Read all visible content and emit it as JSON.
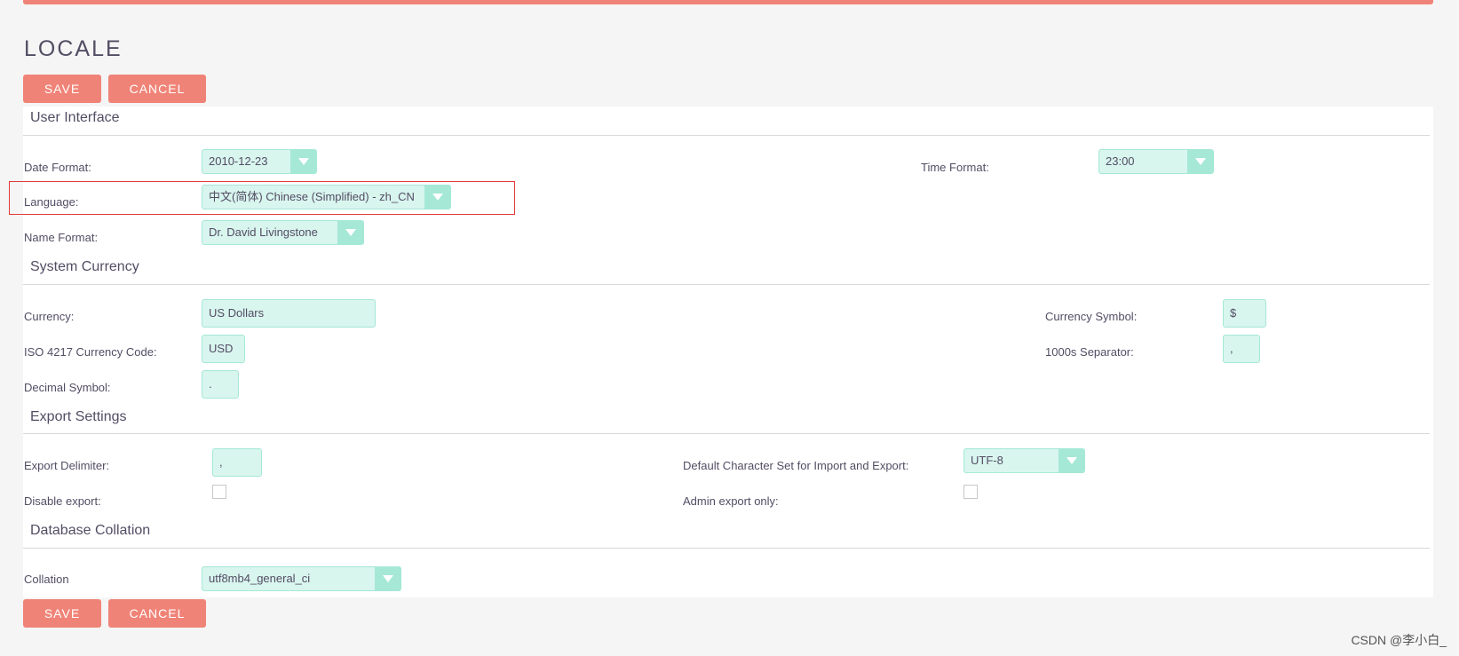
{
  "page": {
    "title": "LOCALE"
  },
  "buttons": {
    "save_label": "SAVE",
    "cancel_label": "CANCEL"
  },
  "sections": {
    "user_interface": {
      "title": "User Interface",
      "date_format": {
        "label": "Date Format:",
        "value": "2010-12-23"
      },
      "time_format": {
        "label": "Time Format:",
        "value": "23:00"
      },
      "language": {
        "label": "Language:",
        "value": "中文(简体) Chinese (Simplified) - zh_CN"
      },
      "name_format": {
        "label": "Name Format:",
        "value": "Dr. David Livingstone"
      }
    },
    "system_currency": {
      "title": "System Currency",
      "currency": {
        "label": "Currency:",
        "value": "US Dollars"
      },
      "currency_symbol": {
        "label": "Currency Symbol:",
        "value": "$"
      },
      "iso_code": {
        "label": "ISO 4217 Currency Code:",
        "value": "USD"
      },
      "thousands_separator": {
        "label": "1000s Separator:",
        "value": ","
      },
      "decimal_symbol": {
        "label": "Decimal Symbol:",
        "value": "."
      }
    },
    "export_settings": {
      "title": "Export Settings",
      "export_delimiter": {
        "label": "Export Delimiter:",
        "value": ","
      },
      "default_charset": {
        "label": "Default Character Set for Import and Export:",
        "value": "UTF-8"
      },
      "disable_export": {
        "label": "Disable export:",
        "checked": false
      },
      "admin_export_only": {
        "label": "Admin export only:",
        "checked": false
      }
    },
    "database_collation": {
      "title": "Database Collation",
      "collation": {
        "label": "Collation",
        "value": "utf8mb4_general_ci"
      }
    }
  },
  "watermark": "CSDN @李小白_",
  "colors": {
    "accent": "#f08377",
    "field_bg": "#d8f5ee",
    "field_border": "#a5e8d6",
    "text": "#534d64",
    "highlight": "#e03a3a"
  }
}
